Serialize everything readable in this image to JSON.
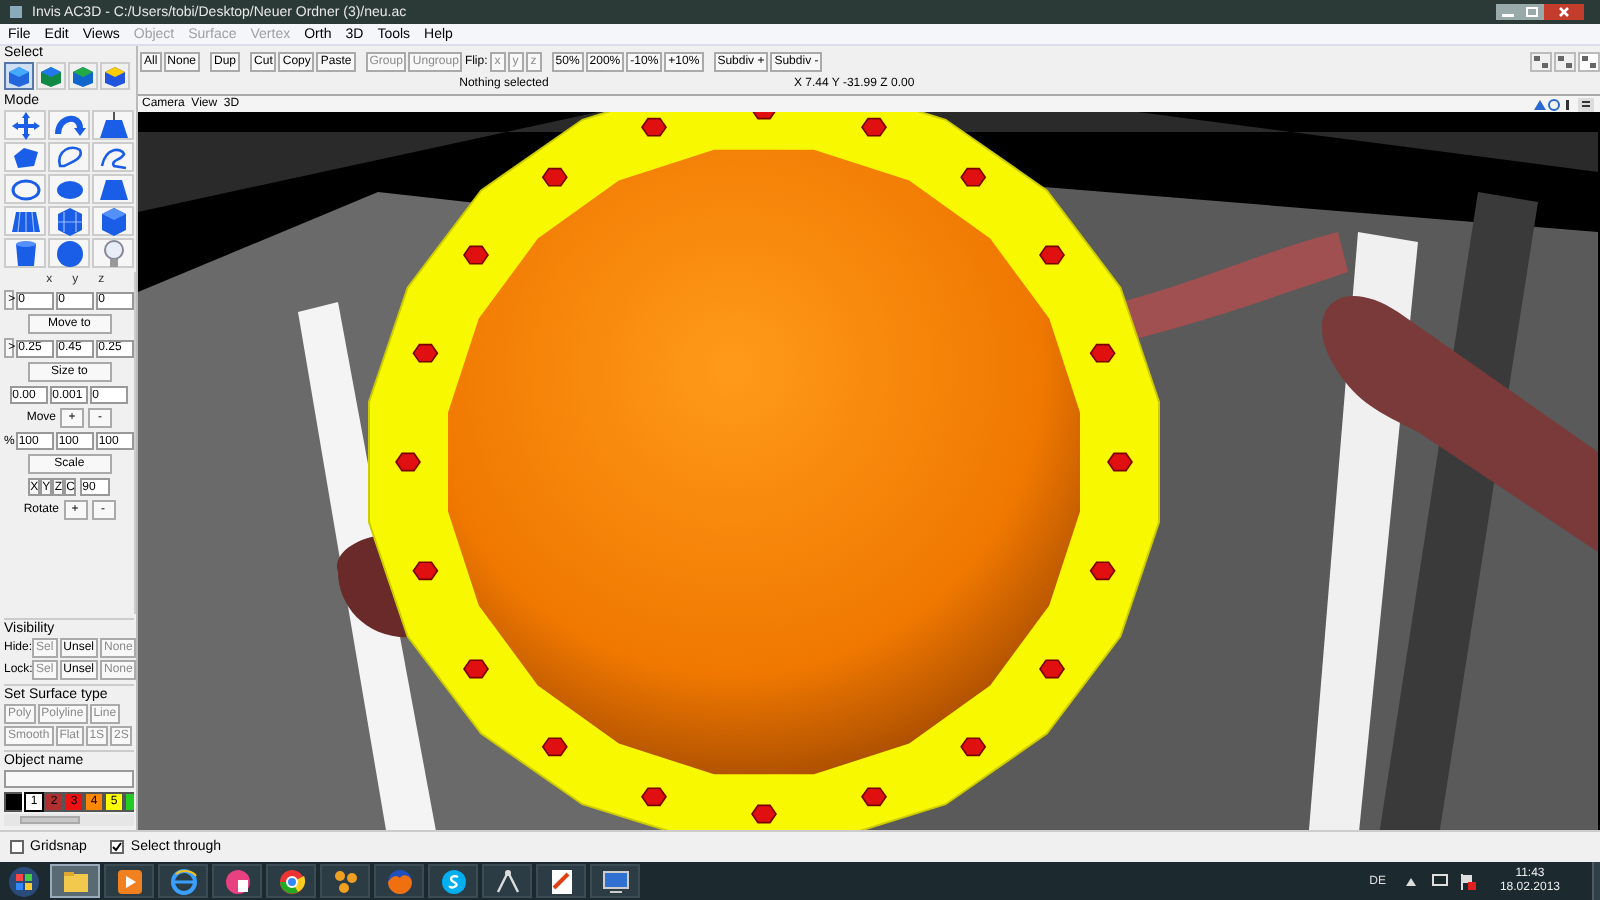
{
  "window": {
    "title": "Invis AC3D - C:/Users/tobi/Desktop/Neuer Ordner (3)/neu.ac"
  },
  "menu": [
    {
      "label": "File",
      "disabled": false
    },
    {
      "label": "Edit",
      "disabled": false
    },
    {
      "label": "Views",
      "disabled": false
    },
    {
      "label": "Object",
      "disabled": true
    },
    {
      "label": "Surface",
      "disabled": true
    },
    {
      "label": "Vertex",
      "disabled": true
    },
    {
      "label": "Orth",
      "disabled": false
    },
    {
      "label": "3D",
      "disabled": false
    },
    {
      "label": "Tools",
      "disabled": false
    },
    {
      "label": "Help",
      "disabled": false
    }
  ],
  "select_panel": {
    "title": "Select",
    "tools": [
      {
        "selected": true
      },
      {
        "selected": false
      },
      {
        "selected": false
      },
      {
        "selected": false
      }
    ]
  },
  "toolbar": [
    {
      "kind": "button",
      "label": "All",
      "disabled": false
    },
    {
      "kind": "button",
      "label": "None",
      "disabled": false
    },
    {
      "kind": "gap"
    },
    {
      "kind": "button",
      "label": "Dup",
      "disabled": false
    },
    {
      "kind": "gap"
    },
    {
      "kind": "button",
      "label": "Cut",
      "disabled": false
    },
    {
      "kind": "button",
      "label": "Copy",
      "disabled": false
    },
    {
      "kind": "button",
      "label": "Paste",
      "disabled": false
    },
    {
      "kind": "gap"
    },
    {
      "kind": "button",
      "label": "Group",
      "disabled": true
    },
    {
      "kind": "button",
      "label": "Ungroup",
      "disabled": true
    },
    {
      "kind": "text",
      "label": "Flip:"
    },
    {
      "kind": "button",
      "label": "x",
      "disabled": true
    },
    {
      "kind": "button",
      "label": "y",
      "disabled": true
    },
    {
      "kind": "button",
      "label": "z",
      "disabled": true
    },
    {
      "kind": "gap"
    },
    {
      "kind": "button",
      "label": "50%",
      "disabled": false
    },
    {
      "kind": "button",
      "label": "200%",
      "disabled": false
    },
    {
      "kind": "button",
      "label": "-10%",
      "disabled": false
    },
    {
      "kind": "button",
      "label": "+10%",
      "disabled": false
    },
    {
      "kind": "gap"
    },
    {
      "kind": "button",
      "label": "Subdiv +",
      "disabled": false
    },
    {
      "kind": "button",
      "label": "Subdiv -",
      "disabled": false
    }
  ],
  "status": {
    "selection": "Nothing selected",
    "coordinates": "X 7.44 Y -31.99 Z 0.00"
  },
  "mode_panel": {
    "title": "Mode"
  },
  "transform": {
    "axes": [
      "x",
      "y",
      "z"
    ],
    "position": {
      "button": ">",
      "values": [
        "0",
        "0",
        "0"
      ],
      "action": "Move to"
    },
    "size": {
      "button": ">",
      "values": [
        "0.25",
        "0.45",
        "0.25"
      ],
      "action": "Size to"
    },
    "move": {
      "values": [
        "0.00",
        "0.001",
        "0"
      ],
      "label": "Move",
      "plus": "+",
      "minus": "-"
    },
    "scale": {
      "prefix": "%",
      "values": [
        "100",
        "100",
        "100"
      ],
      "action": "Scale"
    },
    "rotate": {
      "axis_buttons": [
        {
          "label": "X",
          "selected": false
        },
        {
          "label": "Y",
          "selected": false
        },
        {
          "label": "Z",
          "selected": false
        },
        {
          "label": "C",
          "selected": false
        }
      ],
      "angle": "90",
      "label": "Rotate",
      "plus": "+",
      "minus": "-"
    }
  },
  "visibility": {
    "title": "Visibility",
    "rows": [
      {
        "label": "Hide:",
        "buttons": [
          {
            "label": "Sel",
            "disabled": true
          },
          {
            "label": "Unsel",
            "disabled": false
          },
          {
            "label": "None",
            "disabled": true
          }
        ]
      },
      {
        "label": "Lock:",
        "buttons": [
          {
            "label": "Sel",
            "disabled": true
          },
          {
            "label": "Unsel",
            "disabled": false
          },
          {
            "label": "None",
            "disabled": true
          }
        ]
      }
    ]
  },
  "surface_type": {
    "title": "Set Surface type",
    "rows": [
      [
        {
          "label": "Poly",
          "disabled": true
        },
        {
          "label": "Polyline",
          "disabled": true
        },
        {
          "label": "Line",
          "disabled": true
        }
      ],
      [
        {
          "label": "Smooth",
          "disabled": true
        },
        {
          "label": "Flat",
          "disabled": true
        },
        {
          "label": "1S",
          "disabled": true
        },
        {
          "label": "2S",
          "disabled": true
        }
      ]
    ]
  },
  "object_name": {
    "title": "Object name"
  },
  "palette": [
    {
      "color": "#000000",
      "selected": false
    },
    {
      "label": "1",
      "color": "#ffffff",
      "selected": true
    },
    {
      "label": "2",
      "color": "#b03030",
      "selected": false
    },
    {
      "label": "3",
      "color": "#ee1111",
      "selected": false
    },
    {
      "label": "4",
      "color": "#ff8800",
      "selected": false
    },
    {
      "label": "5",
      "color": "#ffff00",
      "selected": false
    },
    {
      "color": "#22cc22",
      "selected": false
    }
  ],
  "viewport": {
    "title": "Camera  View  3D"
  },
  "bottom_bar": [
    {
      "label": "Gridsnap",
      "checked": false
    },
    {
      "label": "Select through",
      "checked": true
    }
  ],
  "taskbar": {
    "apps": [
      {
        "selected": true
      },
      {
        "selected": false
      },
      {
        "selected": false
      },
      {
        "selected": false
      },
      {
        "selected": false
      },
      {
        "selected": false
      },
      {
        "selected": false
      },
      {
        "selected": false
      },
      {
        "selected": false
      },
      {
        "selected": false
      },
      {
        "selected": false
      }
    ],
    "language": "DE",
    "time": "11:43",
    "date": "18.02.2013"
  }
}
